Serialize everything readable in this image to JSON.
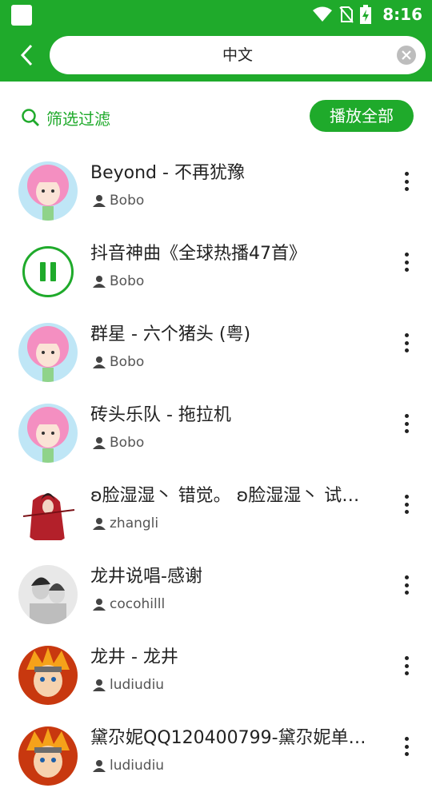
{
  "status_bar": {
    "time": "8:16"
  },
  "search": {
    "query": "中文"
  },
  "toolbar": {
    "filter_label": "筛选过滤",
    "play_all_label": "播放全部"
  },
  "colors": {
    "accent": "#1faa2b"
  },
  "tracks": [
    {
      "title": "Beyond - 不再犹豫",
      "author": "Bobo",
      "thumb": "girl-pink-hair"
    },
    {
      "title": "抖音神曲《全球热播47首》",
      "author": "Bobo",
      "thumb": "pause-icon"
    },
    {
      "title": "群星 - 六个猪头 (粤)",
      "author": "Bobo",
      "thumb": "girl-pink-hair"
    },
    {
      "title": "砖头乐队 - 拖拉机",
      "author": "Bobo",
      "thumb": "girl-pink-hair"
    },
    {
      "title": "ʚ脸湿湿丶  错觉。 ʚ脸湿湿丶 试…",
      "author": "zhangli",
      "thumb": "red-warrior"
    },
    {
      "title": "龙井说唱-感谢",
      "author": "cocohilll",
      "thumb": "sketch-couple"
    },
    {
      "title": "龙井 - 龙井",
      "author": "ludiudiu",
      "thumb": "anime-orange"
    },
    {
      "title": "黛尕妮QQ120400799-黛尕妮单…",
      "author": "ludiudiu",
      "thumb": "anime-orange"
    }
  ]
}
